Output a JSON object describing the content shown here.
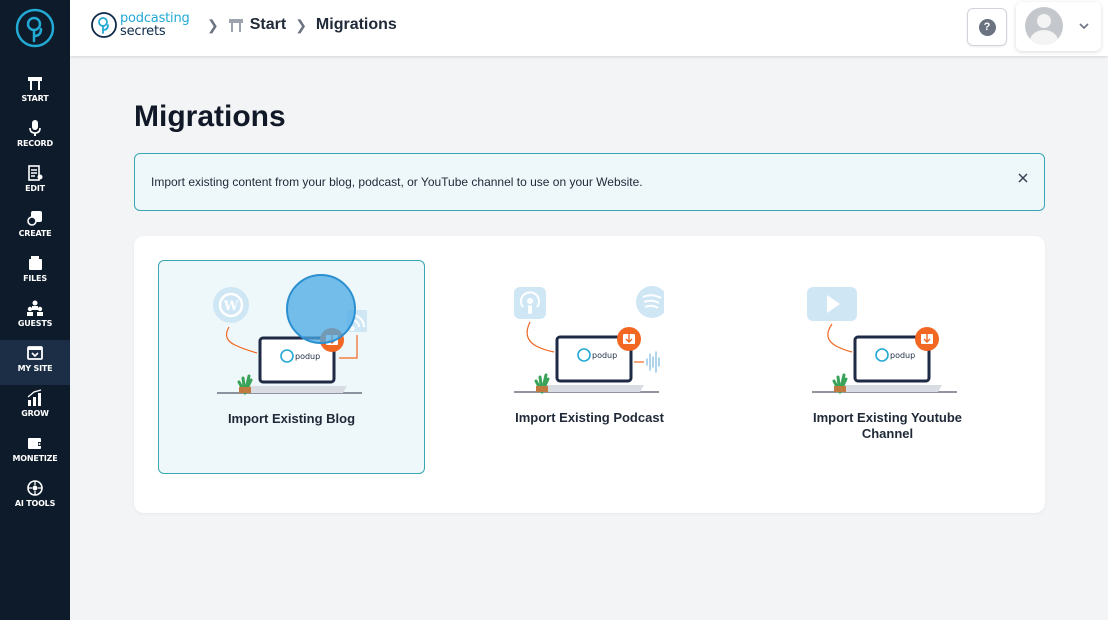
{
  "sidebar": {
    "items": [
      {
        "label": "START",
        "icon": "start-icon"
      },
      {
        "label": "RECORD",
        "icon": "mic-icon"
      },
      {
        "label": "EDIT",
        "icon": "edit-icon"
      },
      {
        "label": "CREATE",
        "icon": "create-icon"
      },
      {
        "label": "FILES",
        "icon": "files-icon"
      },
      {
        "label": "GUESTS",
        "icon": "guests-icon"
      },
      {
        "label": "MY SITE",
        "icon": "site-icon",
        "active": true
      },
      {
        "label": "GROW",
        "icon": "grow-icon"
      },
      {
        "label": "MONETIZE",
        "icon": "monetize-icon"
      },
      {
        "label": "AI TOOLS",
        "icon": "ai-tools-icon"
      }
    ]
  },
  "header": {
    "brand_line1": "podcasting",
    "brand_line2": "secrets",
    "breadcrumb": [
      "Start",
      "Migrations"
    ],
    "help_label": "?"
  },
  "main": {
    "title": "Migrations",
    "alert_text": "Import existing content from your blog, podcast, or YouTube channel to use on your Website.",
    "options": [
      {
        "label": "Import Existing Blog",
        "selected": true,
        "source_icon": "wordpress-icon"
      },
      {
        "label": "Import Existing Podcast",
        "selected": false,
        "source_icon": "podcast-icon"
      },
      {
        "label": "Import Existing Youtube Channel",
        "selected": false,
        "source_icon": "youtube-icon"
      }
    ],
    "laptop_brand": "podup"
  },
  "colors": {
    "sidebar_bg": "#0d1b2a",
    "accent": "#39a6b4",
    "brand_blue": "#22a9d4",
    "badge_orange": "#f26722"
  }
}
